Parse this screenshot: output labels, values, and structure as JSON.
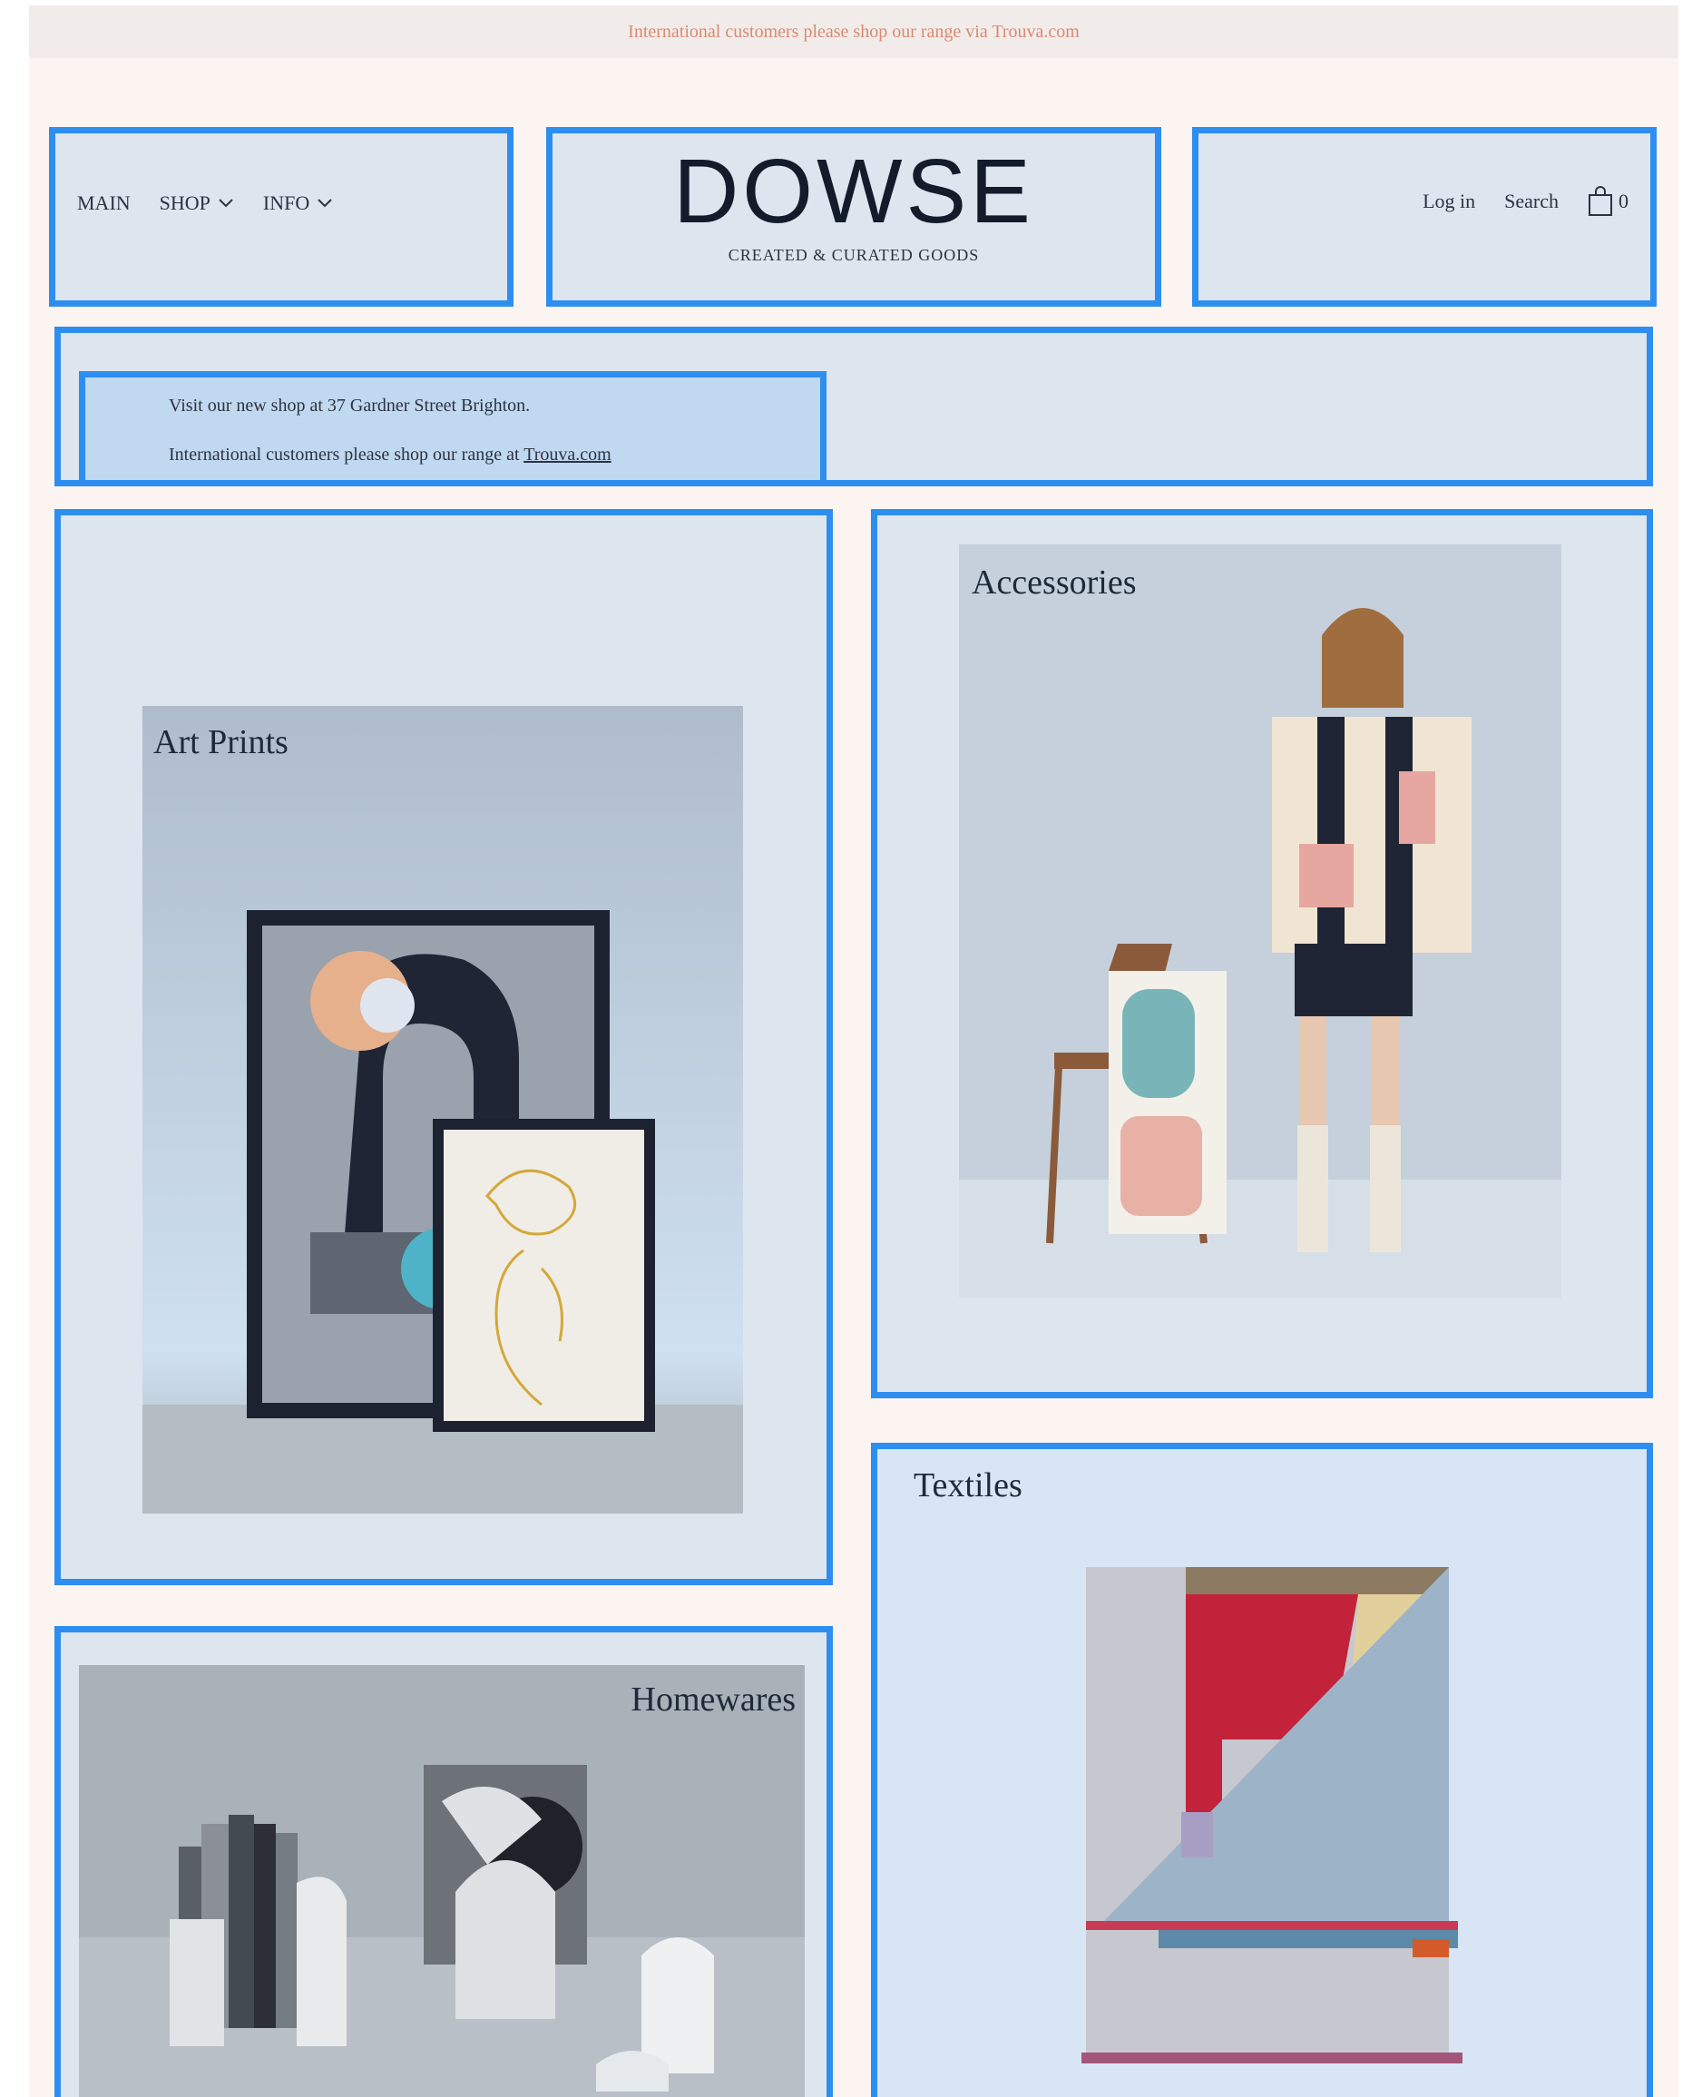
{
  "announcement": {
    "text": "International customers please shop our range via Trouva.com"
  },
  "nav": {
    "items": [
      {
        "label": "MAIN",
        "has_dropdown": false
      },
      {
        "label": "SHOP",
        "has_dropdown": true
      },
      {
        "label": "INFO",
        "has_dropdown": true
      }
    ]
  },
  "logo": {
    "name": "DOWSE",
    "tagline": "CREATED & CURATED GOODS"
  },
  "account": {
    "login_label": "Log in",
    "search_label": "Search",
    "cart_count": "0"
  },
  "notice": {
    "line1": "Visit our new shop at 37 Gardner Street Brighton.",
    "line2_prefix": "International customers please shop our range at",
    "line2_link": "Trouva.com"
  },
  "categories": {
    "art_prints": "Art Prints",
    "accessories": "Accessories",
    "textiles": "Textiles",
    "homewares": "Homewares"
  },
  "colors": {
    "accent_outline": "#2d8ef0",
    "announcement_text": "#d98a72",
    "page_background": "#fcf4f0"
  }
}
